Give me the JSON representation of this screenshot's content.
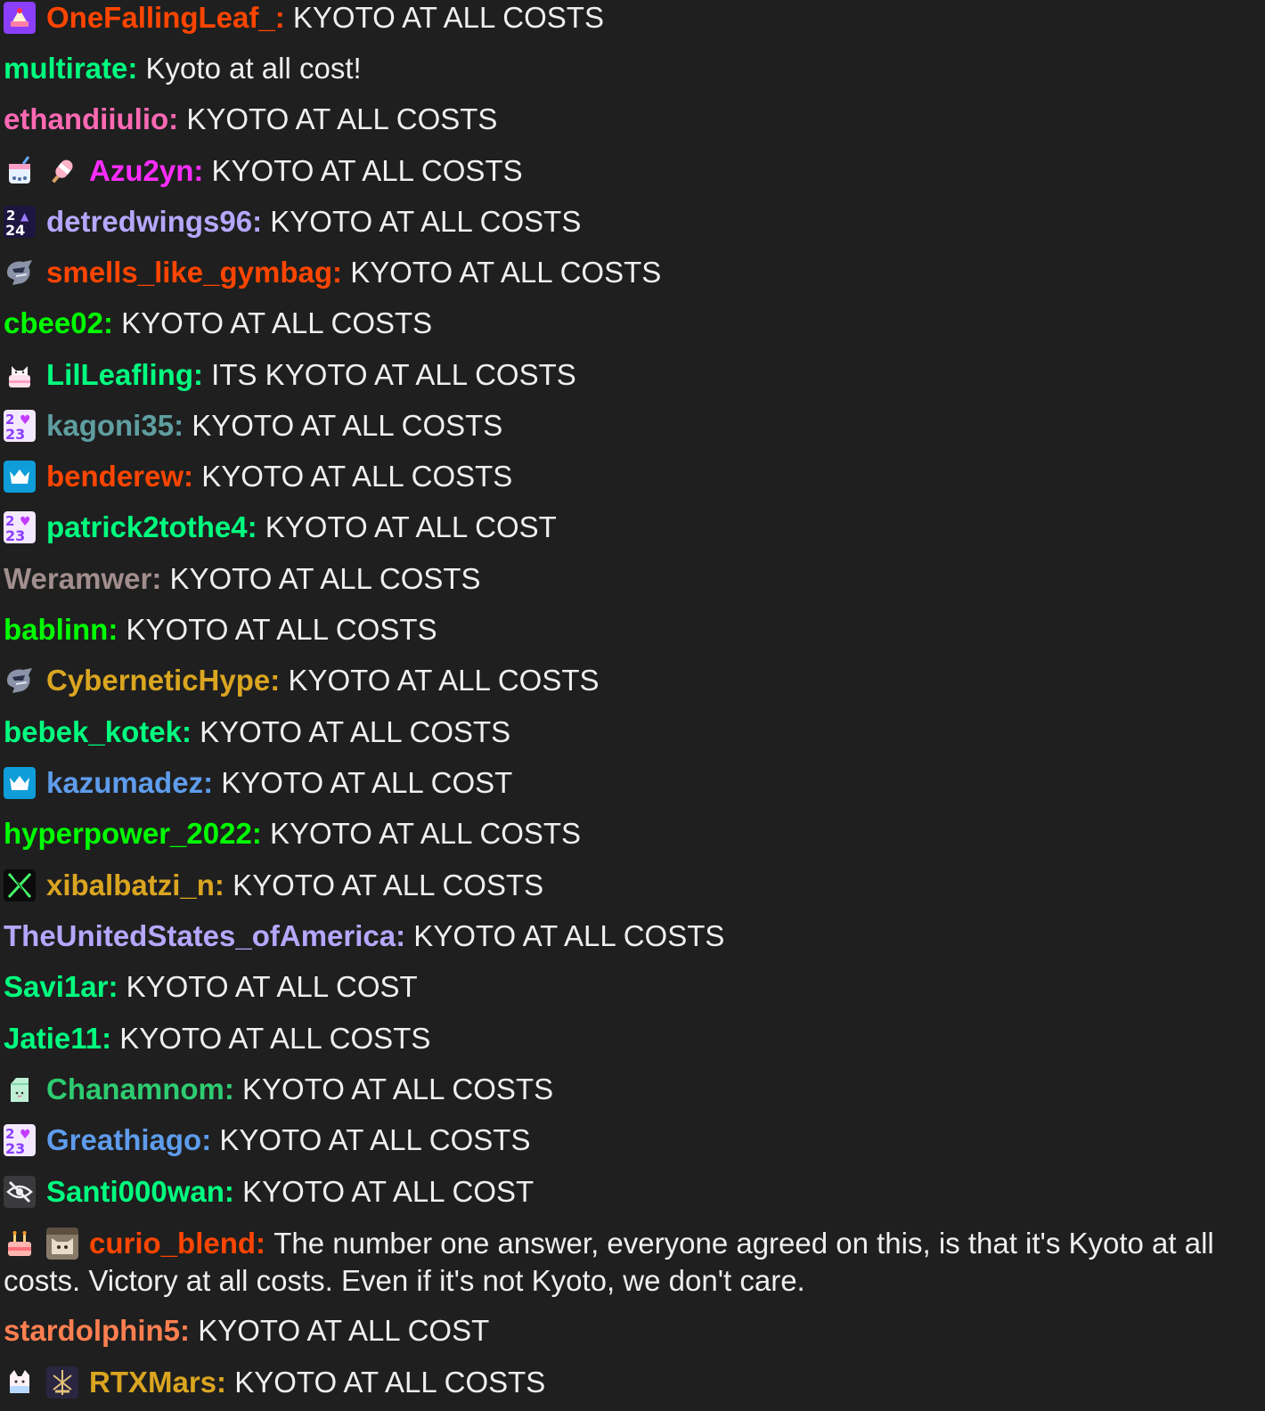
{
  "messages": [
    {
      "badges": [
        "cake-badge"
      ],
      "user": "OneFallingLeaf_",
      "color": "#ff4500",
      "text": "KYOTO AT ALL COSTS"
    },
    {
      "badges": [],
      "user": "multirate",
      "color": "#00ff7f",
      "text": "Kyoto at all cost!"
    },
    {
      "badges": [],
      "user": "ethandiiulio",
      "color": "#ff69b4",
      "text": "KYOTO AT ALL COSTS"
    },
    {
      "badges": [
        "boba-badge",
        "popsicle-badge"
      ],
      "user": "Azu2yn",
      "color": "#ff2cff",
      "text": "KYOTO AT ALL COSTS"
    },
    {
      "badges": [
        "year-2024-badge"
      ],
      "user": "detredwings96",
      "color": "#b4a8ff",
      "text": "KYOTO AT ALL COSTS"
    },
    {
      "badges": [
        "warrior-badge"
      ],
      "user": "smells_like_gymbag",
      "color": "#ff4500",
      "text": "KYOTO AT ALL COSTS"
    },
    {
      "badges": [],
      "user": "cbee02",
      "color": "#00ff00",
      "text": "KYOTO AT ALL COSTS"
    },
    {
      "badges": [
        "cat-cake-badge"
      ],
      "user": "LilLeafling",
      "color": "#00ff7f",
      "text": "ITS KYOTO AT ALL COSTS"
    },
    {
      "badges": [
        "year-2023-badge"
      ],
      "user": "kagoni35",
      "color": "#5f9ea0",
      "text": "KYOTO AT ALL COSTS"
    },
    {
      "badges": [
        "prime-crown-badge"
      ],
      "user": "benderew",
      "color": "#ff4500",
      "text": "KYOTO AT ALL COSTS"
    },
    {
      "badges": [
        "year-2023-badge"
      ],
      "user": "patrick2tothe4",
      "color": "#00ff7f",
      "text": "KYOTO AT ALL COST"
    },
    {
      "badges": [],
      "user": "Weramwer",
      "color": "#a28e8e",
      "text": "KYOTO AT ALL COSTS"
    },
    {
      "badges": [],
      "user": "bablinn",
      "color": "#00ff00",
      "text": "KYOTO AT ALL COSTS"
    },
    {
      "badges": [
        "warrior-badge"
      ],
      "user": "CyberneticHype",
      "color": "#daa520",
      "text": "KYOTO AT ALL COSTS"
    },
    {
      "badges": [],
      "user": "bebek_kotek",
      "color": "#00ff7f",
      "text": "KYOTO AT ALL COSTS"
    },
    {
      "badges": [
        "prime-crown-badge"
      ],
      "user": "kazumadez",
      "color": "#5e9cec",
      "text": "KYOTO AT ALL COST"
    },
    {
      "badges": [],
      "user": "hyperpower_2022",
      "color": "#00ff00",
      "text": "KYOTO AT ALL COSTS"
    },
    {
      "badges": [
        "x-badge"
      ],
      "user": "xibalbatzi_n",
      "color": "#daa520",
      "text": "KYOTO AT ALL COSTS"
    },
    {
      "badges": [],
      "user": "TheUnitedStates_ofAmerica",
      "color": "#b4a8ff",
      "text": "KYOTO AT ALL COSTS"
    },
    {
      "badges": [],
      "user": "Savi1ar",
      "color": "#00ff7f",
      "text": "KYOTO AT ALL COST"
    },
    {
      "badges": [],
      "user": "Jatie11",
      "color": "#00ff7f",
      "text": "KYOTO AT ALL COSTS"
    },
    {
      "badges": [
        "milk-carton-badge"
      ],
      "user": "Chanamnom",
      "color": "#2ecc71",
      "text": "KYOTO AT ALL COSTS"
    },
    {
      "badges": [
        "year-2023-badge"
      ],
      "user": "Greathiago",
      "color": "#5e9cec",
      "text": "KYOTO AT ALL COSTS"
    },
    {
      "badges": [
        "hidden-eye-badge"
      ],
      "user": "Santi000wan",
      "color": "#00ff7f",
      "text": "KYOTO AT ALL COST"
    },
    {
      "badges": [
        "cake-candle-badge",
        "cat-photo-badge"
      ],
      "user": "curio_blend",
      "color": "#ff4500",
      "text": "The number one answer, everyone agreed on this, is that it's Kyoto at all costs. Victory at all costs. Even if it's not Kyoto, we don't care."
    },
    {
      "badges": [],
      "user": "stardolphin5",
      "color": "#ff7f50",
      "text": "KYOTO AT ALL COST"
    },
    {
      "badges": [
        "cat-mask-badge",
        "gold-emblem-badge"
      ],
      "user": "RTXMars",
      "color": "#daa520",
      "text": "KYOTO AT ALL COSTS"
    }
  ]
}
